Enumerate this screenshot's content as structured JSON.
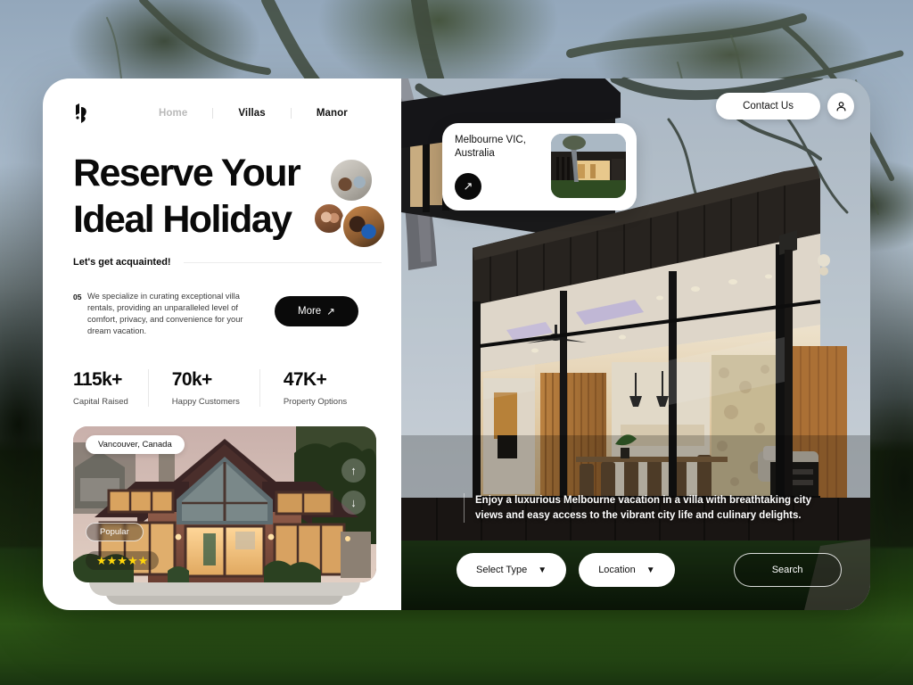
{
  "brand": {
    "logo_icon": "abstract-leaf-logo"
  },
  "nav": {
    "items": [
      {
        "label": "Home",
        "active": false
      },
      {
        "label": "Villas",
        "active": true
      },
      {
        "label": "Manor",
        "active": true
      }
    ]
  },
  "hero_left": {
    "headline_line1": "Reserve Your",
    "headline_line2": "Ideal Holiday",
    "acquainted_label": "Let's get acquainted!",
    "desc_number": "05",
    "description": "We specialize in curating exceptional villa rentals, providing an unparalleled level of comfort, privacy, and convenience for your dream vacation.",
    "more_button": "More",
    "more_icon": "arrow-up-right-icon"
  },
  "stats": [
    {
      "value": "115k+",
      "label": "Capital Raised"
    },
    {
      "value": "70k+",
      "label": "Happy Customers"
    },
    {
      "value": "47K+",
      "label": "Property Options"
    }
  ],
  "property_card": {
    "location_chip": "Vancouver, Canada",
    "popular_badge": "Popular",
    "stars": "★★★★★",
    "rating_count": 5,
    "scroll_up_icon": "arrow-up-icon",
    "scroll_down_icon": "arrow-down-icon"
  },
  "header_right": {
    "contact_button": "Contact Us",
    "account_icon": "user-account-icon"
  },
  "place_card": {
    "name_line1": "Melbourne VIC,",
    "name_line2": "Australia",
    "go_icon": "arrow-up-right-icon",
    "thumbnail_alt": "melbourne-villa-thumbnail"
  },
  "hero_right": {
    "blurb": "Enjoy a luxurious Melbourne vacation in a villa with breathtaking city views and easy access to the vibrant city life and culinary delights.",
    "search": {
      "select_type_label": "Select Type",
      "location_label": "Location",
      "search_button": "Search",
      "caret_icon": "chevron-down-icon"
    }
  },
  "colors": {
    "accent_black": "#0a0a0a",
    "surface_white": "#ffffff",
    "star_yellow": "#FFD60A",
    "muted_nav": "#b9b9b9"
  }
}
